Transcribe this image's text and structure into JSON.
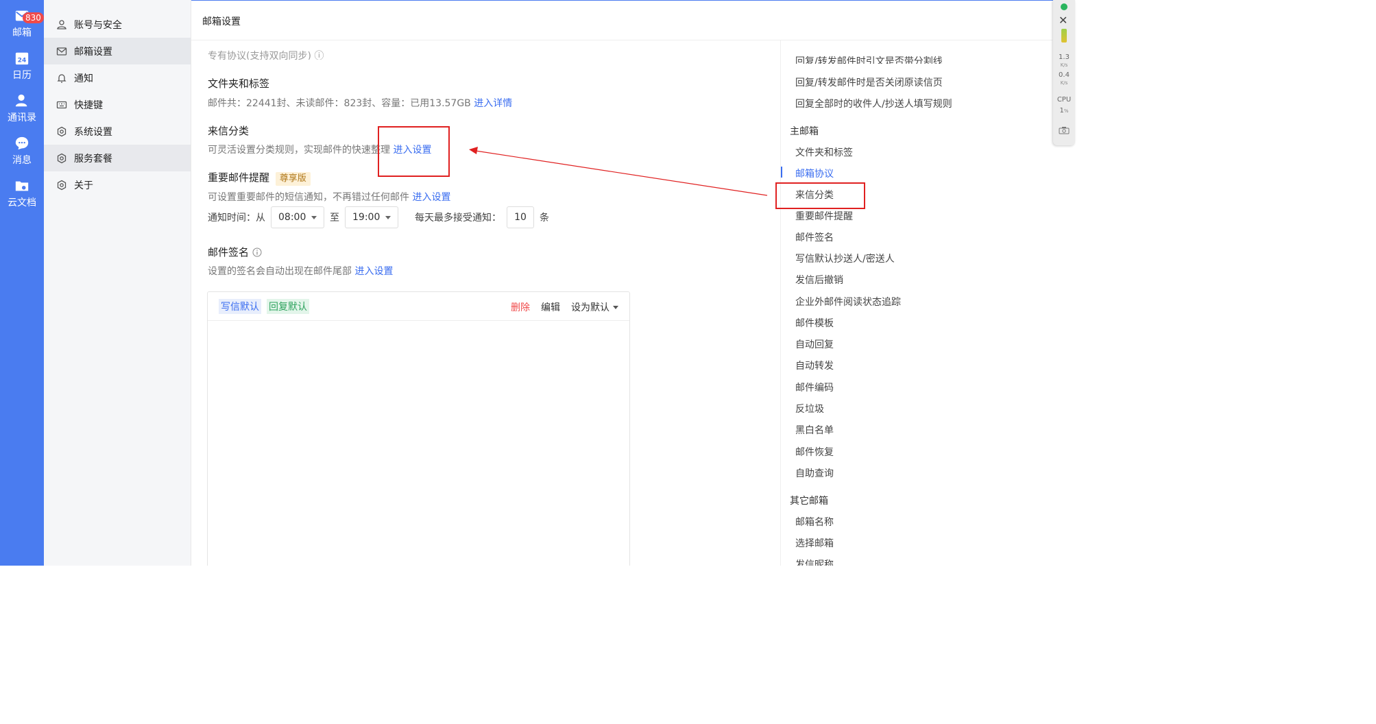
{
  "rail": {
    "items": [
      {
        "label": "邮箱",
        "icon": "mail-icon"
      },
      {
        "label": "日历",
        "icon": "calendar-icon",
        "day": "24"
      },
      {
        "label": "通讯录",
        "icon": "contacts-icon"
      },
      {
        "label": "消息",
        "icon": "chat-icon"
      },
      {
        "label": "云文档",
        "icon": "cloud-doc-icon"
      }
    ],
    "mail_badge": "830",
    "color": "#4a7cf0"
  },
  "nav": {
    "items": [
      {
        "label": "账号与安全",
        "icon": "user-icon"
      },
      {
        "label": "邮箱设置",
        "icon": "mail-icon"
      },
      {
        "label": "通知",
        "icon": "bell-icon"
      },
      {
        "label": "快捷键",
        "icon": "keyboard-icon"
      },
      {
        "label": "系统设置",
        "icon": "gear-icon"
      },
      {
        "label": "服务套餐",
        "icon": "gear-icon"
      },
      {
        "label": "关于",
        "icon": "gear-icon"
      }
    ]
  },
  "header": {
    "title": "邮箱设置"
  },
  "main": {
    "cut_top_text": "专有协议(支持双向同步) ⓘ",
    "folders": {
      "title": "文件夹和标签",
      "desc": "邮件共：22441封、未读邮件：823封、容量：已用13.57GB",
      "link": "进入详情"
    },
    "classify": {
      "title": "来信分类",
      "desc": "可灵活设置分类规则，实现邮件的快速整理",
      "link": "进入设置"
    },
    "important": {
      "title": "重要邮件提醒",
      "tag": "尊享版",
      "desc": "可设置重要邮件的短信通知，不再错过任何邮件",
      "link": "进入设置",
      "time_label": "通知时间：从",
      "from": "08:00",
      "to_label": "至",
      "to": "19:00",
      "max_label": "每天最多接受通知：",
      "max_value": "10",
      "unit": "条"
    },
    "signature": {
      "title": "邮件签名",
      "desc": "设置的签名会自动出现在邮件尾部",
      "link": "进入设置",
      "chip_write": "写信默认",
      "chip_reply": "回复默认",
      "delete": "删除",
      "edit": "编辑",
      "set_default": "设为默认"
    }
  },
  "toc": {
    "cut_item": "回复/转发邮件时引文是否带分割线",
    "items_top": [
      "回复/转发邮件时是否关闭原读信页",
      "回复全部时的收件人/抄送人填写规则"
    ],
    "group_main": "主邮箱",
    "items_main": [
      "文件夹和标签",
      "邮箱协议",
      "来信分类",
      "重要邮件提醒",
      "邮件签名",
      "写信默认抄送人/密送人",
      "发信后撤销",
      "企业外邮件阅读状态追踪",
      "邮件模板",
      "自动回复",
      "自动转发",
      "邮件编码",
      "反垃圾",
      "黑白名单",
      "邮件恢复",
      "自助查询"
    ],
    "group_other": "其它邮箱",
    "items_other": [
      "邮箱名称",
      "选择邮箱",
      "发信昵称"
    ]
  },
  "widget": {
    "up_value": "1.3",
    "up_unit": "K/s",
    "down_value": "0.4",
    "down_unit": "K/s",
    "cpu_label": "CPU",
    "cpu_value": "1",
    "cpu_unit": "%"
  }
}
